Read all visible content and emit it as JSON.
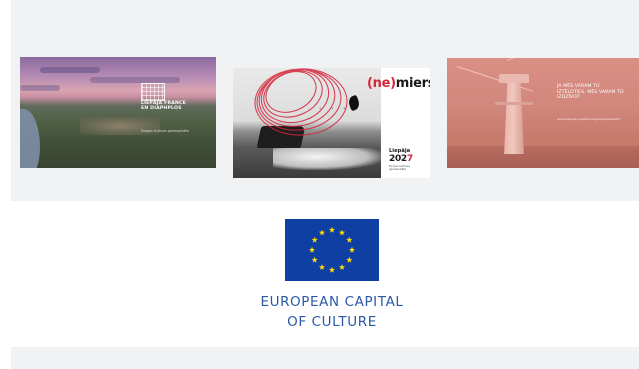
{
  "colors": {
    "band": "#f1f2f4",
    "eu_blue": "#103fa3",
    "eu_star": "#ffdd00",
    "caption_blue": "#2b59a6",
    "accent_red": "#d2263a"
  },
  "gallery": {
    "image1": {
      "overlay_title": "LIEPĀJA FRANCE\nEN DIAPHPLOS",
      "overlay_sub": "Eiropas Kultūras galvaspilsēta"
    },
    "image2": {
      "brand_open": "(ne)",
      "brand_rest": "miers",
      "city": "Liepāja",
      "year_prefix": "202",
      "year_suffix": "7",
      "tagline": "Eiropas kultūras galvaspilsēta"
    },
    "image3": {
      "quote": "JA MĒS VARAM TO IZTĒLOTIES, MĒS VARAM TO IZDZĪVOT",
      "small": "www.liepajaeiropaskulturasgalvaspilseta2027"
    }
  },
  "caption": {
    "line1": "EUROPEAN CAPITAL",
    "line2": "OF CULTURE"
  }
}
